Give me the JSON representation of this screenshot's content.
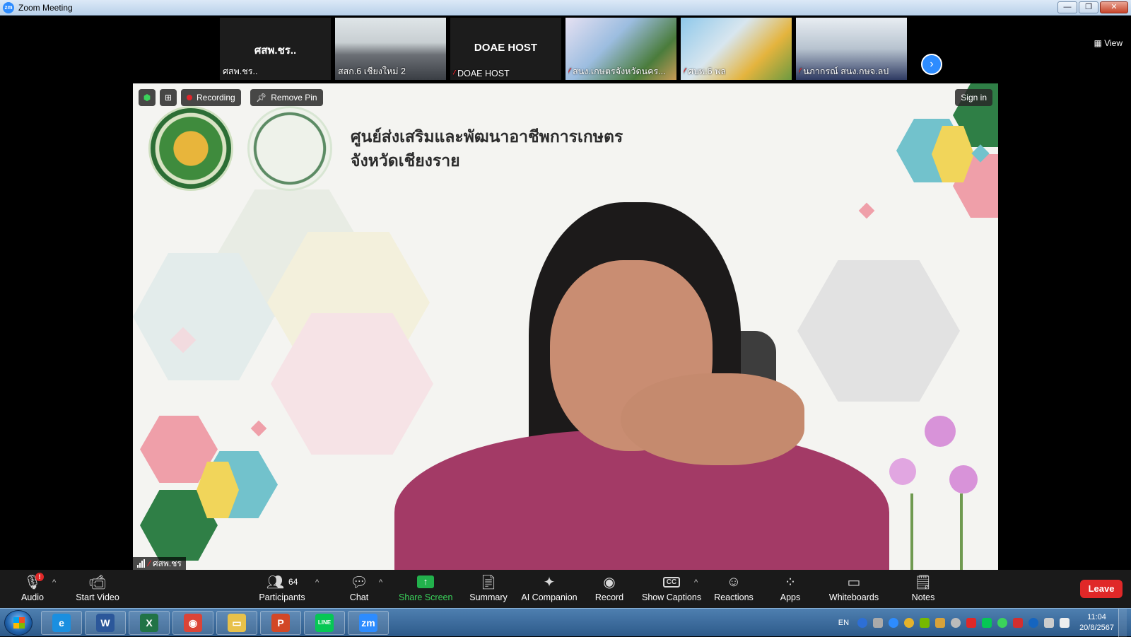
{
  "window": {
    "title": "Zoom Meeting",
    "app_icon": "zm",
    "minimize": "—",
    "restore": "❐",
    "close": "✕"
  },
  "strip": {
    "thumbnails": [
      {
        "name": "ศสพ.ชร..",
        "display_text": "ศสพ.ชร..",
        "muted": false
      },
      {
        "name": "สสก.6 เชียงใหม่ 2",
        "muted": false
      },
      {
        "name": "DOAE HOST",
        "display_text": "DOAE HOST",
        "muted": true
      },
      {
        "name": "สนง.เกษตรจังหวัดนคร...",
        "muted": true
      },
      {
        "name": "ศบพ.6 พล",
        "muted": true
      },
      {
        "name": "นภากรณ์ สนง.กษจ.ลป",
        "muted": true
      }
    ],
    "next_icon": "chevron-right-icon",
    "view_label": "View"
  },
  "main": {
    "org_title_line1": "ศูนย์ส่งเสริมและพัฒนาอาชีพการเกษตร",
    "org_title_line2": "จังหวัดเชียงราย",
    "recording_label": "Recording",
    "remove_pin_label": "Remove Pin",
    "sign_in_label": "Sign in",
    "speaker_name": "ศสพ.ชร"
  },
  "toolbar": {
    "audio": "Audio",
    "audio_badge": "!",
    "start_video": "Start Video",
    "participants": "Participants",
    "participants_count": "64",
    "chat": "Chat",
    "share_screen": "Share Screen",
    "summary": "Summary",
    "ai_companion": "AI Companion",
    "record": "Record",
    "show_captions": "Show Captions",
    "reactions": "Reactions",
    "apps": "Apps",
    "whiteboards": "Whiteboards",
    "notes": "Notes",
    "leave": "Leave"
  },
  "taskbar": {
    "apps": [
      {
        "name": "internet-explorer",
        "glyph": "e",
        "color": "#1a8fe0"
      },
      {
        "name": "word",
        "glyph": "W",
        "color": "#2b579a"
      },
      {
        "name": "excel",
        "glyph": "X",
        "color": "#217346"
      },
      {
        "name": "chrome",
        "glyph": "◉",
        "color": "#db4437"
      },
      {
        "name": "file-explorer",
        "glyph": "▭",
        "color": "#e8c14a"
      },
      {
        "name": "powerpoint",
        "glyph": "P",
        "color": "#d24726"
      },
      {
        "name": "line",
        "glyph": "LINE",
        "color": "#06c755"
      },
      {
        "name": "zoom",
        "glyph": "zm",
        "color": "#2d8cff"
      }
    ],
    "language": "EN",
    "time": "11:04",
    "date": "20/8/2567"
  },
  "colors": {
    "zoom_blue": "#2d8cff",
    "leave_red": "#e02828",
    "share_green": "#22b14c",
    "muted_red": "#e0252b"
  }
}
